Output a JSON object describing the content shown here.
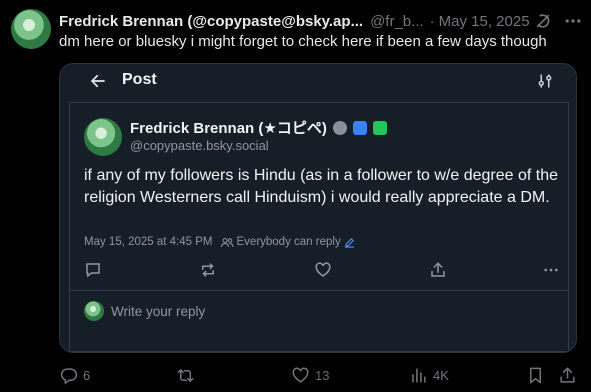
{
  "tweet": {
    "author_name": "Fredrick Brennan (@copypaste@bsky.ap...",
    "author_handle": "@fr_b...",
    "dot": "·",
    "date": "May 15, 2025",
    "text": "dm here or bluesky i might forget to check here if been a few days though"
  },
  "embed": {
    "title": "Post",
    "card": {
      "name": "Fredrick Brennan (★コピペ)",
      "handle": "@copypaste.bsky.social",
      "body": "if any of my followers is Hindu (as in a follower to w/e degree of the religion Westerners call Hinduism) i would really appreciate a DM.",
      "timestamp": "May 15, 2025 at 4:45 PM",
      "reply_setting": "Everybody can reply",
      "reply_placeholder": "Write your reply"
    }
  },
  "stats": {
    "replies": "6",
    "views": "4K"
  },
  "colors": {
    "background": "#000000",
    "embed_background": "#161e27",
    "muted_text": "#71767b"
  }
}
